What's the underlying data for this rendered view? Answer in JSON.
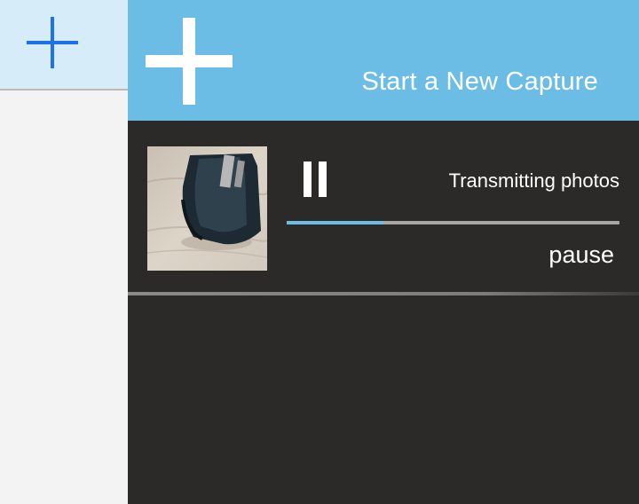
{
  "sidebar": {
    "add_icon": "plus-icon",
    "accent_color": "#1a73e8"
  },
  "capture_header": {
    "icon": "plus-icon",
    "title": "Start a New Capture",
    "color": "#6cbde6"
  },
  "job": {
    "thumbnail": "photo-thumbnail",
    "control_icon": "pause-icon",
    "status": "Transmitting photos",
    "progress": 0.29,
    "action_label": "pause"
  }
}
